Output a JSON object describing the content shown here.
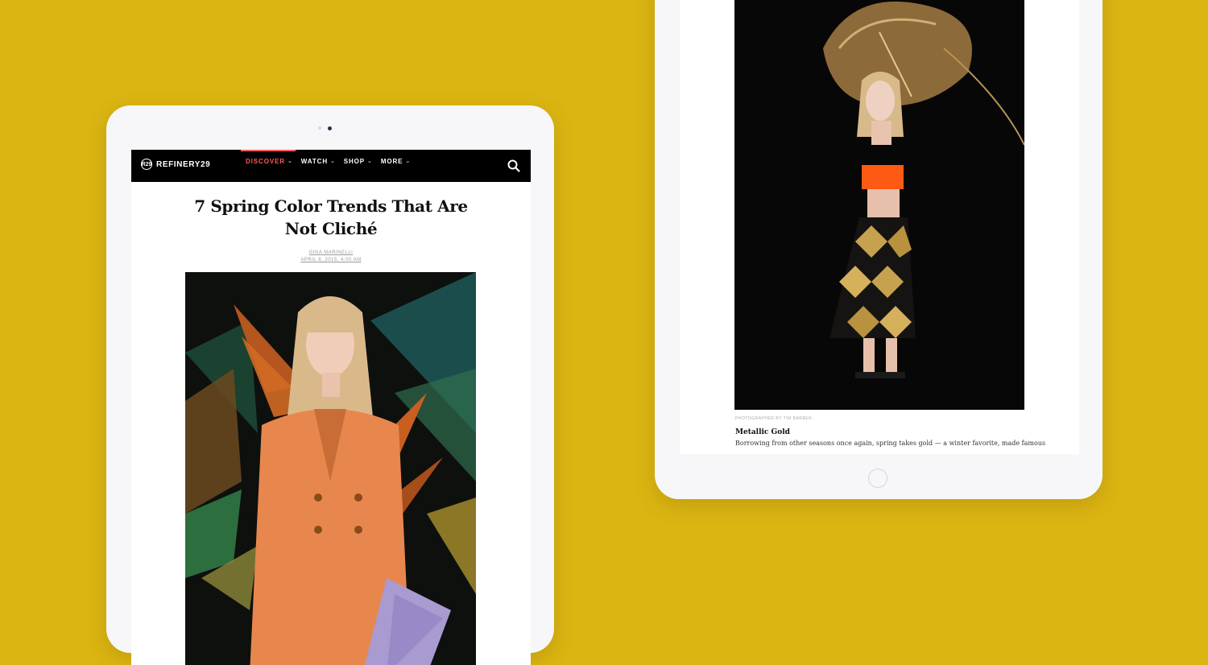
{
  "left_tablet": {
    "site": {
      "logo_text": "REFINERY29",
      "logo_mark": "R29",
      "nav_items": [
        {
          "label": "DISCOVER",
          "active": true
        },
        {
          "label": "WATCH",
          "active": false
        },
        {
          "label": "SHOP",
          "active": false
        },
        {
          "label": "MORE",
          "active": false
        }
      ],
      "caret_icon": "chevron-down-icon",
      "search_icon": "search-icon",
      "accent_color": "#ff5b5b"
    },
    "article": {
      "title_line1": "7 Spring Color Trends That Are",
      "title_line2": "Not Cliché",
      "author": "GINA MARINELLI",
      "date": "APRIL 8, 2015, 4:00 AM"
    }
  },
  "right_tablet": {
    "photo_credit": "PHOTOGRAPHED BY TIM BARBER.",
    "section_title": "Metallic Gold",
    "section_text": "Borrowing from other seasons once again, spring takes gold — a winter favorite, made famous"
  },
  "colors": {
    "background": "#dbb512",
    "device_frame": "#f7f7fa",
    "navbar": "#000000"
  }
}
